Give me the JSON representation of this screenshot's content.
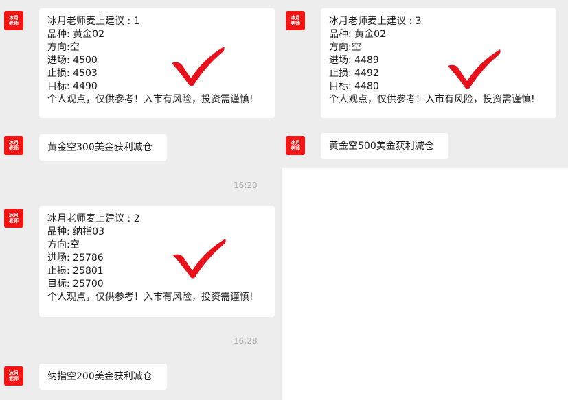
{
  "avatar_text": "冰月\n老师",
  "messages": {
    "card1": {
      "title": "冰月老师麦上建议 : 1",
      "product": "品种:  黄金02",
      "direction": "方向:空",
      "entry": "进场:  4500",
      "stop": "止损:  4503",
      "target": "目标:  4490",
      "disclaimer": "个人观点，仅供参考！入市有风险，投资需谨慎!"
    },
    "short1": "黄金空300美金获利减仓",
    "time1": "16:20",
    "card2": {
      "title": "冰月老师麦上建议 : 2",
      "product": "品种:  纳指03",
      "direction": "方向:空",
      "entry": "进场:  25786",
      "stop": "止损:  25801",
      "target": "目标:  25700",
      "disclaimer": "个人观点，仅供参考！入市有风险，投资需谨慎!"
    },
    "time2": "16:28",
    "short2": "纳指空200美金获利减仓",
    "card3": {
      "title": "冰月老师麦上建议 : 3",
      "product": "品种:  黄金02",
      "direction": "方向:空",
      "entry": "进场:  4489",
      "stop": "止损:  4492",
      "target": "目标:  4480",
      "disclaimer": "个人观点，仅供参考！入市有风险，投资需谨慎!"
    },
    "short3": "黄金空500美金获利减仓"
  },
  "colors": {
    "panel_bg": "#ededed",
    "avatar_red": "#f31414",
    "check_red": "#e8101a",
    "time_gray": "#a6a6a6"
  },
  "icons": {
    "check": "red-checkmark-icon"
  }
}
